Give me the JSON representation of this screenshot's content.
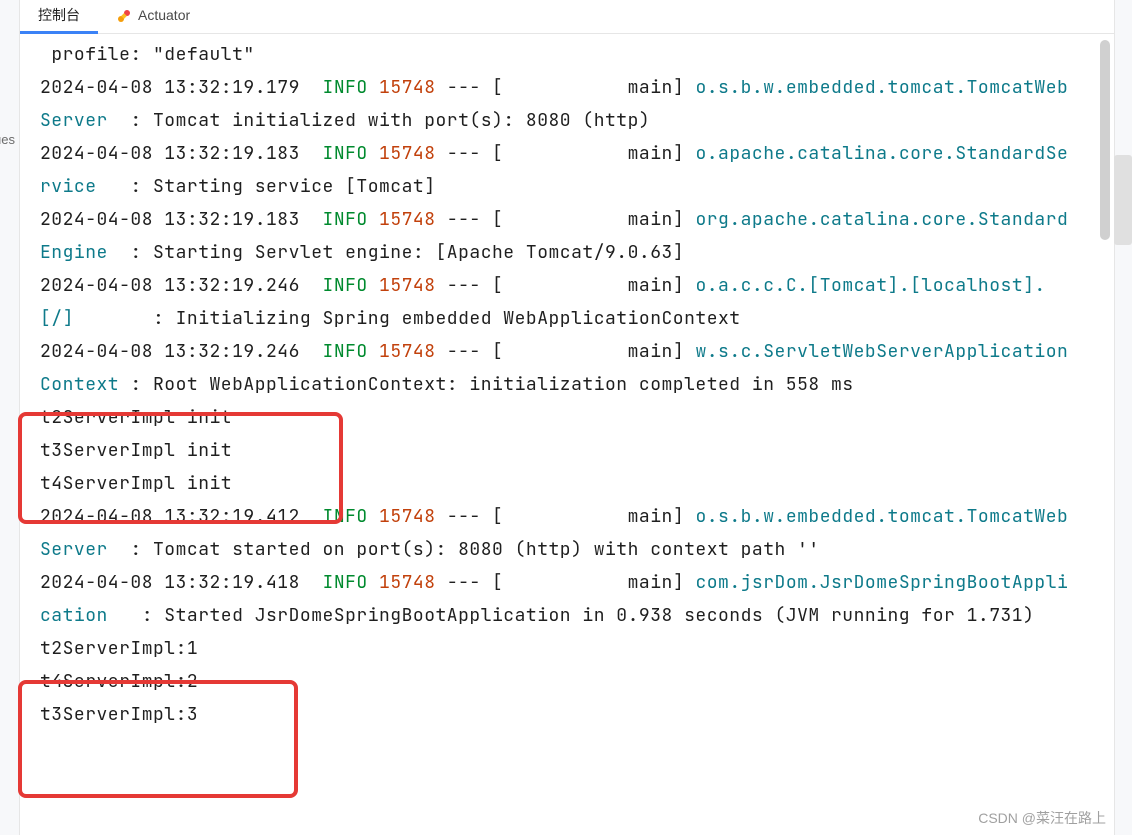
{
  "tabs": {
    "console": "控制台",
    "actuator": "Actuator"
  },
  "log": {
    "l0_profile": " profile: \"default\"",
    "l1_ts": "2024-04-08 13:32:19.179",
    "l1_level": "INFO",
    "l1_pid": "15748",
    "l1_sep": " --- [           main] ",
    "l1_logger": "o.s.b.w.embedded.tomcat.TomcatWebServer",
    "l1_msg": "  : Tomcat initialized with port(s): 8080 (http)",
    "l2_ts": "2024-04-08 13:32:19.183",
    "l2_level": "INFO",
    "l2_pid": "15748",
    "l2_sep": " --- [           main] ",
    "l2_logger": "o.apache.catalina.core.StandardService",
    "l2_msg": "   : Starting service [Tomcat]",
    "l3_ts": "2024-04-08 13:32:19.183",
    "l3_level": "INFO",
    "l3_pid": "15748",
    "l3_sep": " --- [           main] ",
    "l3_logger": "org.apache.catalina.core.StandardEngine",
    "l3_msg": "  : Starting Servlet engine: [Apache Tomcat/9.0.63]",
    "l4_ts": "2024-04-08 13:32:19.246",
    "l4_level": "INFO",
    "l4_pid": "15748",
    "l4_sep": " --- [           main] ",
    "l4_logger": "o.a.c.c.C.[Tomcat].[localhost].[/]",
    "l4_msg": "       : Initializing Spring embedded WebApplicationContext",
    "l5_ts": "2024-04-08 13:32:19.246",
    "l5_level": "INFO",
    "l5_pid": "15748",
    "l5_sep": " --- [           main] ",
    "l5_logger": "w.s.c.ServletWebServerApplicationContext",
    "l5_msg": " : Root WebApplicationContext: initialization completed in 558 ms",
    "l6": "t2ServerImpl init",
    "l7": "t3ServerImpl init",
    "l8": "t4ServerImpl init",
    "l9_ts": "2024-04-08 13:32:19.412",
    "l9_level": "INFO",
    "l9_pid": "15748",
    "l9_sep": " --- [           main] ",
    "l9_logger": "o.s.b.w.embedded.tomcat.TomcatWebServer",
    "l9_msg": "  : Tomcat started on port(s): 8080 (http) with context path ''",
    "l10_ts": "2024-04-08 13:32:19.418",
    "l10_level": "INFO",
    "l10_pid": "15748",
    "l10_sep": " --- [           main] ",
    "l10_logger": "com.jsrDom.JsrDomeSpringBootApplication",
    "l10_msg": "   : Started JsrDomeSpringBootApplication in 0.938 seconds (JVM running for 1.731)",
    "l11": "t2ServerImpl:1",
    "l12": "t4ServerImpl:2",
    "l13": "t3ServerImpl:3"
  },
  "left_label": "ues",
  "watermark": "CSDN @菜汪在路上"
}
